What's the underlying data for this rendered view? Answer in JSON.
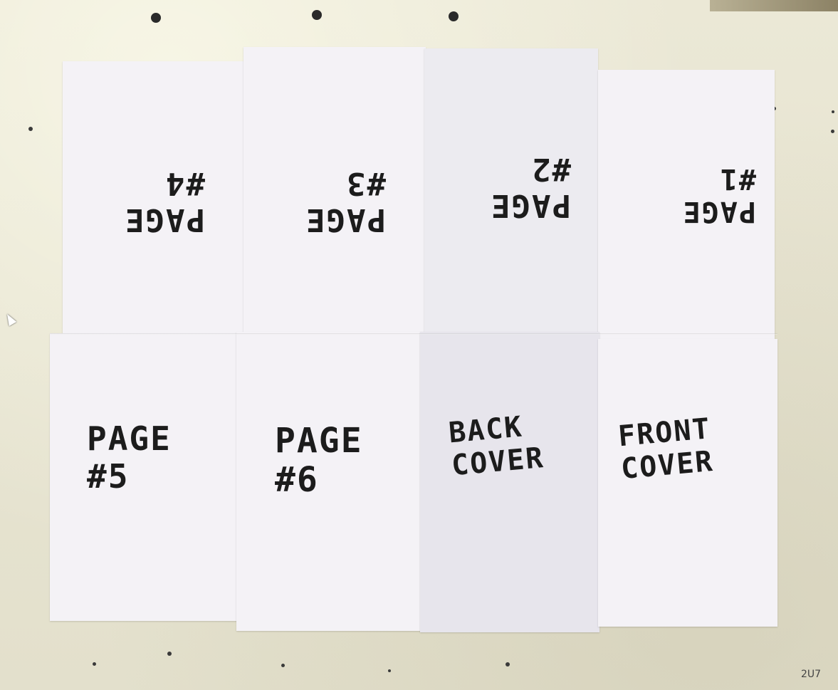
{
  "photo": {
    "subject": "folded paper booklet template",
    "panels_top": [
      {
        "id": "page4",
        "text": "PAGE\n#4"
      },
      {
        "id": "page3",
        "text": "PAGE\n#3"
      },
      {
        "id": "page2",
        "text": "PAGE\n#2"
      },
      {
        "id": "page1",
        "text": "PAGE\n#1"
      }
    ],
    "panels_bottom": [
      {
        "id": "page5",
        "text": "PAGE\n#5"
      },
      {
        "id": "page6",
        "text": "PAGE\n#6"
      },
      {
        "id": "back_cover",
        "text": "BACK\nCOVER"
      },
      {
        "id": "front_cover",
        "text": "FRONT\nCOVER"
      }
    ],
    "corner_mark": "2U7"
  },
  "colors": {
    "paper": "#f4f2f6",
    "ink": "#1c1c1c",
    "table": "#e9e6d4"
  }
}
